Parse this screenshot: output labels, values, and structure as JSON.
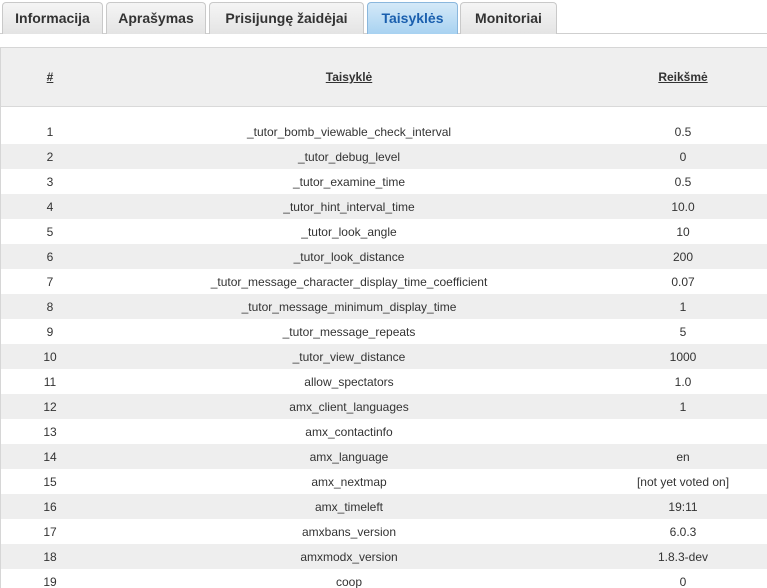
{
  "tabs": [
    {
      "label": "Informacija",
      "active": false
    },
    {
      "label": "Aprašymas",
      "active": false
    },
    {
      "label": "Prisijungę žaidėjai",
      "active": false
    },
    {
      "label": "Taisyklės",
      "active": true
    },
    {
      "label": "Monitoriai",
      "active": false
    }
  ],
  "table": {
    "headers": {
      "num": "#",
      "rule": "Taisyklė",
      "value": "Reikšmė"
    },
    "rows": [
      {
        "num": "1",
        "rule": "_tutor_bomb_viewable_check_interval",
        "value": "0.5"
      },
      {
        "num": "2",
        "rule": "_tutor_debug_level",
        "value": "0"
      },
      {
        "num": "3",
        "rule": "_tutor_examine_time",
        "value": "0.5"
      },
      {
        "num": "4",
        "rule": "_tutor_hint_interval_time",
        "value": "10.0"
      },
      {
        "num": "5",
        "rule": "_tutor_look_angle",
        "value": "10"
      },
      {
        "num": "6",
        "rule": "_tutor_look_distance",
        "value": "200"
      },
      {
        "num": "7",
        "rule": "_tutor_message_character_display_time_coefficient",
        "value": "0.07"
      },
      {
        "num": "8",
        "rule": "_tutor_message_minimum_display_time",
        "value": "1"
      },
      {
        "num": "9",
        "rule": "_tutor_message_repeats",
        "value": "5"
      },
      {
        "num": "10",
        "rule": "_tutor_view_distance",
        "value": "1000"
      },
      {
        "num": "11",
        "rule": "allow_spectators",
        "value": "1.0"
      },
      {
        "num": "12",
        "rule": "amx_client_languages",
        "value": "1"
      },
      {
        "num": "13",
        "rule": "amx_contactinfo",
        "value": ""
      },
      {
        "num": "14",
        "rule": "amx_language",
        "value": "en"
      },
      {
        "num": "15",
        "rule": "amx_nextmap",
        "value": "[not yet voted on]"
      },
      {
        "num": "16",
        "rule": "amx_timeleft",
        "value": "19:11"
      },
      {
        "num": "17",
        "rule": "amxbans_version",
        "value": "6.0.3"
      },
      {
        "num": "18",
        "rule": "amxmodx_version",
        "value": "1.8.3-dev"
      },
      {
        "num": "19",
        "rule": "coop",
        "value": "0"
      }
    ]
  }
}
